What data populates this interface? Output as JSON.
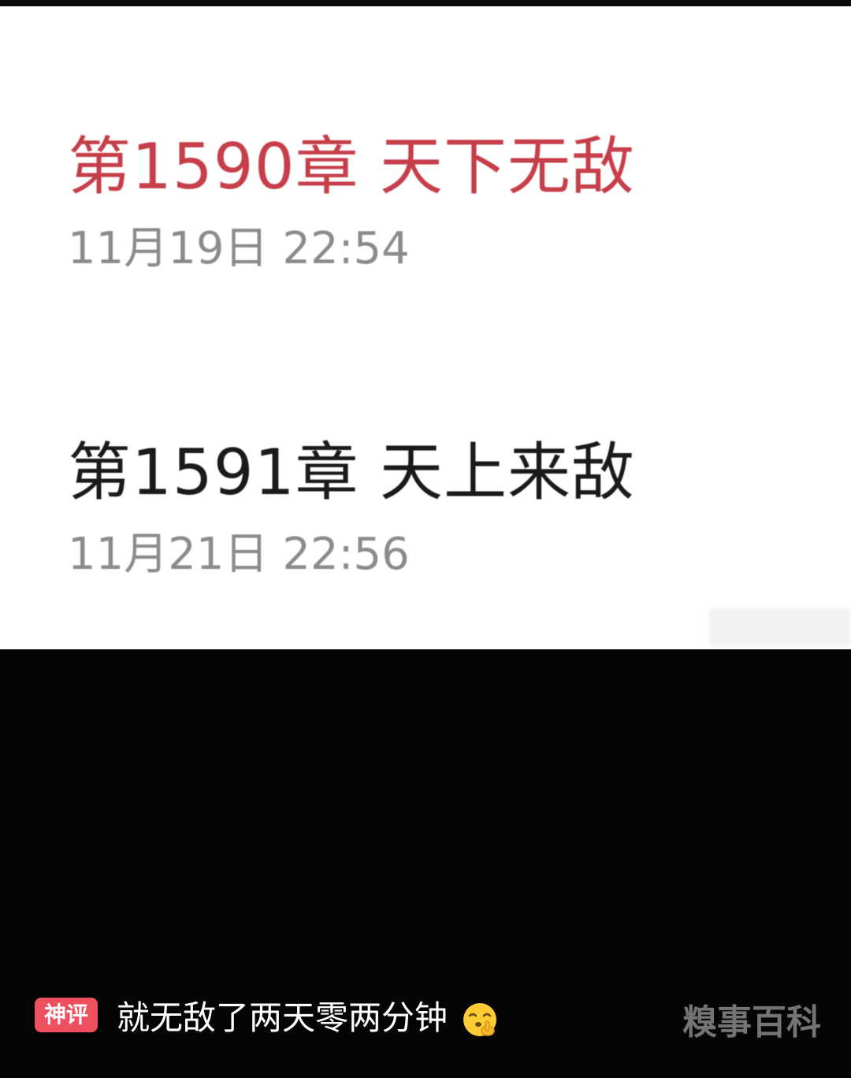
{
  "chapters": [
    {
      "title": "第1590章  天下无敌",
      "date": "11月19日 22:54",
      "color": "#c63e49"
    },
    {
      "title": "第1591章  天上来敌",
      "date": "11月21日 22:56",
      "color": "#1a1a1a"
    }
  ],
  "caption": {
    "badge": "神评",
    "text": "就无敌了两天零两分钟",
    "emoji": "shushing-face-emoji",
    "badge_color": "#ef5060"
  },
  "watermark": {
    "text": "糗事百科"
  }
}
